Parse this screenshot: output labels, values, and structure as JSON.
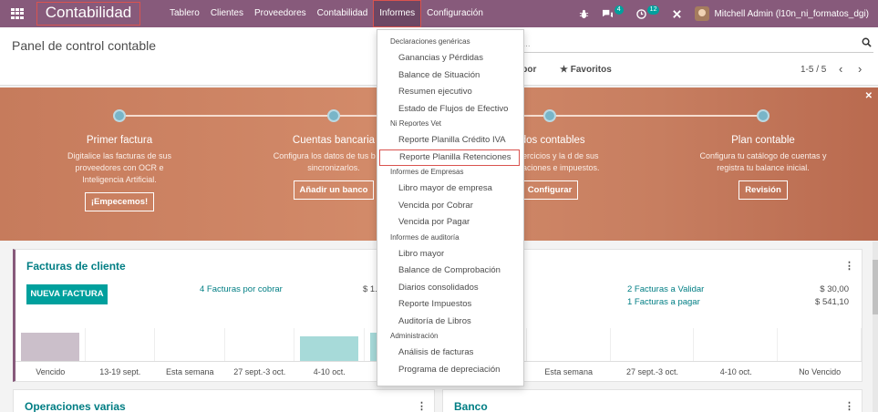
{
  "navbar": {
    "app_title": "Contabilidad",
    "menu": [
      "Tablero",
      "Clientes",
      "Proveedores",
      "Contabilidad",
      "Informes",
      "Configuración"
    ],
    "active_menu": "Informes",
    "messages_count": "4",
    "activities_count": "12",
    "user_name": "Mitchell Admin (l10n_ni_formatos_dgi)"
  },
  "control_panel": {
    "title": "Panel de control contable",
    "search_placeholder": "Buscar...",
    "search_visible_text": "car...",
    "group_by": "ar por",
    "favorites": "Favoritos",
    "pager": "1-5 / 5"
  },
  "onboarding": {
    "steps": [
      {
        "title": "Primer factura",
        "desc": "Digitalice las facturas de sus proveedores con OCR e Inteligencia Artificial.",
        "button": "¡Empecemos!"
      },
      {
        "title": "Cuentas bancaria",
        "desc": "Configura los datos de tus b para sincronizarlos.",
        "button": "Añadir un banco"
      },
      {
        "title": "odos contables",
        "desc": "sus ejercicios y la d de sus declaraciones e impuestos.",
        "button": "Configurar"
      },
      {
        "title": "Plan contable",
        "desc": "Configura tu catálogo de cuentas y registra tu balance inicial.",
        "button": "Revisión"
      }
    ]
  },
  "cards": {
    "customer_invoices": {
      "title": "Facturas de cliente",
      "new_button": "NUEVA FACTURA",
      "to_collect": "4 Facturas por cobrar",
      "amount": "$ 1.",
      "chart_labels": [
        "Vencido",
        "13-19 sept.",
        "Esta semana",
        "27 sept.-3 oct.",
        "4-10 oct.",
        "N"
      ],
      "chart_values": [
        0.85,
        0,
        0,
        0,
        0.75,
        0.85
      ]
    },
    "vendor_bills": {
      "title": "oveedores",
      "to_validate": "2 Facturas a Validar",
      "to_validate_amount": "$ 30,00",
      "to_pay": "1 Facturas a pagar",
      "to_pay_amount": "$ 541,10",
      "chart_labels": [
        "13-19 sept.",
        "Esta semana",
        "27 sept.-3 oct.",
        "4-10 oct.",
        "No Vencido"
      ]
    },
    "misc": {
      "title": "Operaciones varias"
    },
    "bank": {
      "title": "Banco"
    }
  },
  "dropdown": {
    "sections": [
      {
        "header": "Declaraciones genéricas",
        "items": [
          "Ganancias y Pérdidas",
          "Balance de Situación",
          "Resumen ejecutivo",
          "Estado de Flujos de Efectivo"
        ]
      },
      {
        "header": "Ni Reportes Vet",
        "items": [
          "Reporte Planilla Crédito IVA",
          "Reporte Planilla Retenciones"
        ]
      },
      {
        "header": "Informes de Empresas",
        "items": [
          "Libro mayor de empresa",
          "Vencida por Cobrar",
          "Vencida por Pagar"
        ]
      },
      {
        "header": "Informes de auditoría",
        "items": [
          "Libro mayor",
          "Balance de Comprobación",
          "Diarios consolidados",
          "Reporte Impuestos",
          "Auditoría de Libros"
        ]
      },
      {
        "header": "Administración",
        "items": [
          "Análisis de facturas",
          "Programa de depreciación"
        ]
      }
    ],
    "highlighted_item": "Reporte Planilla Retenciones"
  },
  "colors": {
    "navbar": "#875a7b",
    "accent": "#00a09d",
    "link": "#017e84",
    "highlight_border": "#d9534f"
  }
}
